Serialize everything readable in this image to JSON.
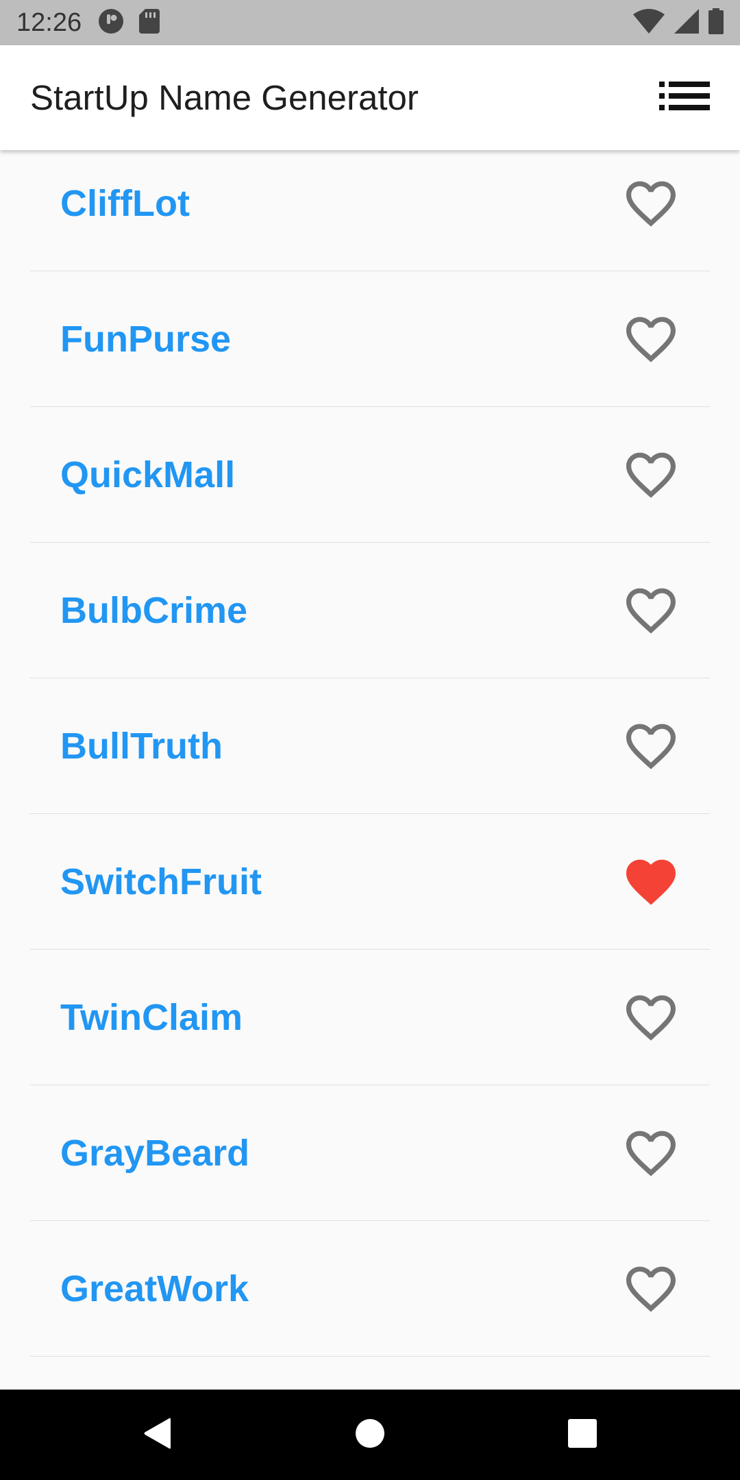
{
  "status_bar": {
    "time": "12:26",
    "icons": [
      "notification-icon",
      "sd-card-icon",
      "wifi-icon",
      "signal-icon",
      "battery-icon"
    ]
  },
  "app_bar": {
    "title": "StartUp Name Generator",
    "action_icon": "list-icon"
  },
  "list": {
    "items": [
      {
        "name": "CliffLot",
        "saved": false
      },
      {
        "name": "FunPurse",
        "saved": false
      },
      {
        "name": "QuickMall",
        "saved": false
      },
      {
        "name": "BulbCrime",
        "saved": false
      },
      {
        "name": "BullTruth",
        "saved": false
      },
      {
        "name": "SwitchFruit",
        "saved": true
      },
      {
        "name": "TwinClaim",
        "saved": false
      },
      {
        "name": "GrayBeard",
        "saved": false
      },
      {
        "name": "GreatWork",
        "saved": false
      }
    ]
  },
  "colors": {
    "accent": "#2196f3",
    "favorite": "#f44336",
    "icon_gray": "#757575",
    "app_bar": "#ffffff",
    "status_bar": "#bdbdbd",
    "nav_bar": "#000000"
  },
  "nav_bar": {
    "buttons": [
      "back-icon",
      "home-icon",
      "recents-icon"
    ]
  }
}
